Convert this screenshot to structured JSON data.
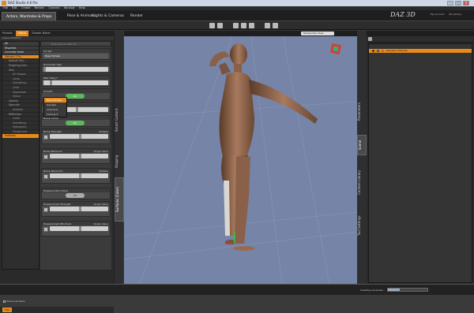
{
  "window": {
    "title": "DAZ Studio 4.6 Pro"
  },
  "menu": [
    "File",
    "Edit",
    "Create",
    "Render",
    "Connect",
    "Window",
    "Help"
  ],
  "room_tabs": [
    "Actors, Wardrobe & Props",
    "Pose & Animate",
    "Lights & Cameras",
    "Render"
  ],
  "logo": "DAZ 3D",
  "user_links": [
    "My Account",
    "My Library"
  ],
  "left_panel": {
    "tabs": [
      "Presets",
      "Editor",
      "Shader Baker"
    ],
    "active_tab": "Editor",
    "subtabs": "Scene  Modifiers",
    "categories": [
      {
        "label": "All",
        "kind": "head"
      },
      {
        "label": "Favorites",
        "kind": "head"
      },
      {
        "label": "Currently Used",
        "kind": "head"
      },
      {
        "label": "Genesis 2 Fe...",
        "kind": "sel"
      },
      {
        "label": "Default Tem...",
        "kind": "sub"
      },
      {
        "label": "Fingering Surf...",
        "kind": "sub"
      },
      {
        "label": "Skin",
        "kind": "sub"
      },
      {
        "label": "All Shapes",
        "kind": "sub2"
      },
      {
        "label": "Lamp",
        "kind": "sub2"
      },
      {
        "label": "Something",
        "kind": "sub2"
      },
      {
        "label": "Limb",
        "kind": "sub2"
      },
      {
        "label": "Impression",
        "kind": "sub2"
      },
      {
        "label": "Velour",
        "kind": "sub2"
      },
      {
        "label": "Opacity",
        "kind": "sub"
      },
      {
        "label": "Specular",
        "kind": "sub"
      },
      {
        "label": "Ambient",
        "kind": "sub2"
      },
      {
        "label": "Reflection",
        "kind": "sub"
      },
      {
        "label": "Lamb",
        "kind": "sub2"
      },
      {
        "label": "Something",
        "kind": "sub2"
      },
      {
        "label": "Hydrophilic",
        "kind": "sub2"
      },
      {
        "label": "Translucent",
        "kind": "sub2"
      },
      {
        "label": "Surfaces",
        "kind": "sel"
      }
    ],
    "search_placeholder": "Enter text to filter by...",
    "show_sub_items": "Show sub items",
    "tips_label": "Tips"
  },
  "properties": [
    {
      "label": "UV Set",
      "type": "dropdown",
      "value": "Base Female"
    },
    {
      "label": "Horizontal Tiles",
      "type": "slider",
      "value": 0.0
    },
    {
      "label": "Max Tiling Y",
      "type": "slider",
      "value": 0.1
    },
    {
      "label": "Smooth",
      "type": "toggle",
      "value": "On"
    },
    {
      "label": "Angle",
      "type": "slider",
      "value": 0.5
    },
    {
      "label": "Bump Active",
      "type": "toggle",
      "value": "On"
    },
    {
      "label": "Bump Strength",
      "type": "map",
      "map": "Multiple",
      "value": 0.5
    },
    {
      "label": "Bump Minimum",
      "type": "map",
      "map": "Single Value",
      "value": 0.5
    },
    {
      "label": "Bump Maximum",
      "type": "map",
      "map": "Multiple",
      "value": 0.5
    },
    {
      "label": "Displacement Active",
      "type": "toggle",
      "value": "Off"
    },
    {
      "label": "Displacement Strength",
      "type": "map",
      "map": "Single Value",
      "value": 0.5
    },
    {
      "label": "Displacement Minimum",
      "type": "map",
      "map": "Single Value",
      "value": 0.5
    }
  ],
  "dropdown_options": [
    "Base Female",
    "Genesis",
    "Victoria 6",
    "Victoria 5"
  ],
  "left_side_tabs": [
    "Smart Content",
    "Shaping",
    "Surfaces (Color)"
  ],
  "viewport": {
    "camera": "Perspective View"
  },
  "right_side_tabs": [
    "Parameters",
    "Scene",
    "Content Library",
    "Tool Settings"
  ],
  "scene": {
    "item": "Genesis 2 Female"
  },
  "status": {
    "label": "Creating a preview...",
    "progress": 0.3
  }
}
